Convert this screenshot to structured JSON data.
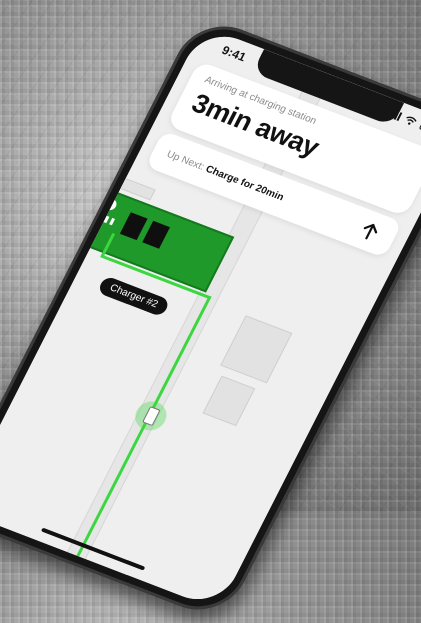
{
  "status_bar": {
    "time": "9:41"
  },
  "trip": {
    "arriving_label": "Arriving at charging station",
    "eta": "3min away"
  },
  "next": {
    "prefix": "Up Next:",
    "action": "Charge for 20min",
    "arrow_icon": "arrow-up-icon"
  },
  "map": {
    "charger_tag": "Charger #2",
    "colors": {
      "route": "#3cd640",
      "station": "#1f9a2a"
    }
  }
}
